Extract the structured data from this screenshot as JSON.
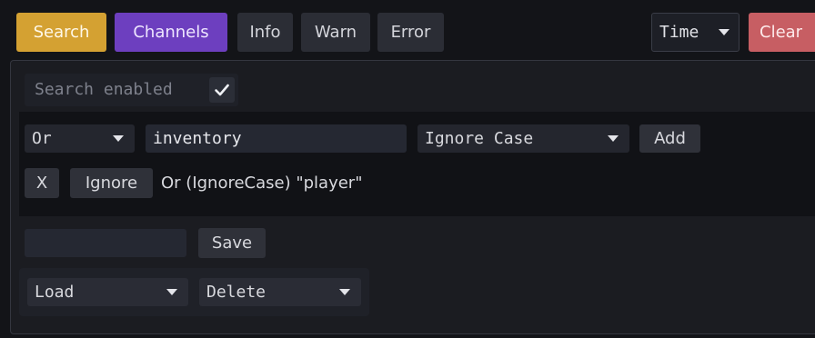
{
  "colors": {
    "search_active": "#d4a132",
    "channels_active": "#6d3fbf",
    "clear_button": "#c75e63",
    "panel_bg": "#1b1c21",
    "filter_area_bg": "#111216"
  },
  "toolbar": {
    "search_label": "Search",
    "channels_label": "Channels",
    "info_label": "Info",
    "warn_label": "Warn",
    "error_label": "Error",
    "time_select": "Time",
    "clear_label": "Clear"
  },
  "search_panel": {
    "enabled_label": "Search enabled",
    "enabled_checked": true,
    "new_filter": {
      "logic_select": "Or",
      "text_value": "inventory",
      "case_select": "Ignore Case",
      "add_label": "Add"
    },
    "filters": [
      {
        "remove_label": "X",
        "mode_label": "Ignore",
        "description": "Or (IgnoreCase) \"player\""
      }
    ],
    "save_input_value": "",
    "save_label": "Save",
    "load_select": "Load",
    "delete_select": "Delete"
  }
}
